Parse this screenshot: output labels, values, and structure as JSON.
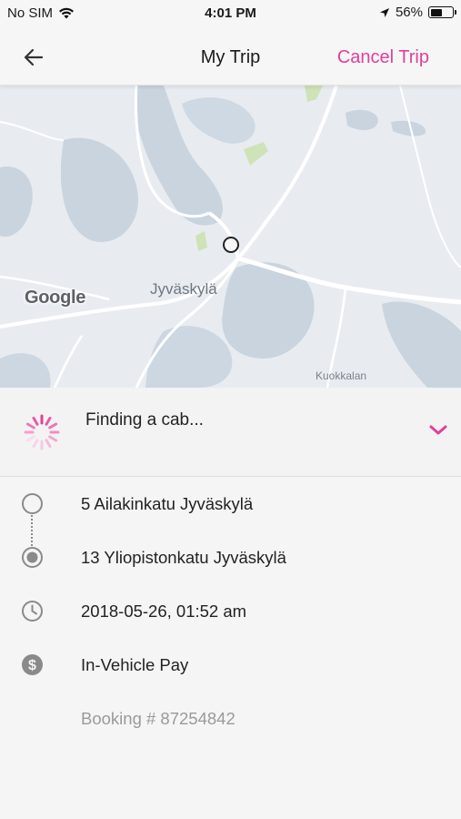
{
  "status_bar": {
    "carrier": "No SIM",
    "time": "4:01 PM",
    "battery_percent": "56%",
    "battery_level": 0.56
  },
  "nav": {
    "back_icon": "arrow-left-icon",
    "title": "My Trip",
    "cancel_label": "Cancel Trip",
    "accent_color": "#e0409c"
  },
  "map": {
    "city_label": "Jyväskylä",
    "district_label": "Kuokkalan",
    "attribution": "Google"
  },
  "trip_status": {
    "text": "Finding a cab...",
    "spinner_icon": "loading-spinner-icon",
    "expand_icon": "chevron-down-icon"
  },
  "details": {
    "pickup": {
      "icon": "circle-outline-icon",
      "text": "5 Ailakinkatu Jyväskylä"
    },
    "dropoff": {
      "icon": "radio-dot-icon",
      "text": "13 Yliopistonkatu Jyväskylä"
    },
    "time": {
      "icon": "clock-icon",
      "text": "2018-05-26, 01:52 am"
    },
    "payment": {
      "icon": "dollar-circle-icon",
      "text": "In-Vehicle Pay"
    },
    "booking": {
      "text": "Booking # 87254842"
    }
  }
}
